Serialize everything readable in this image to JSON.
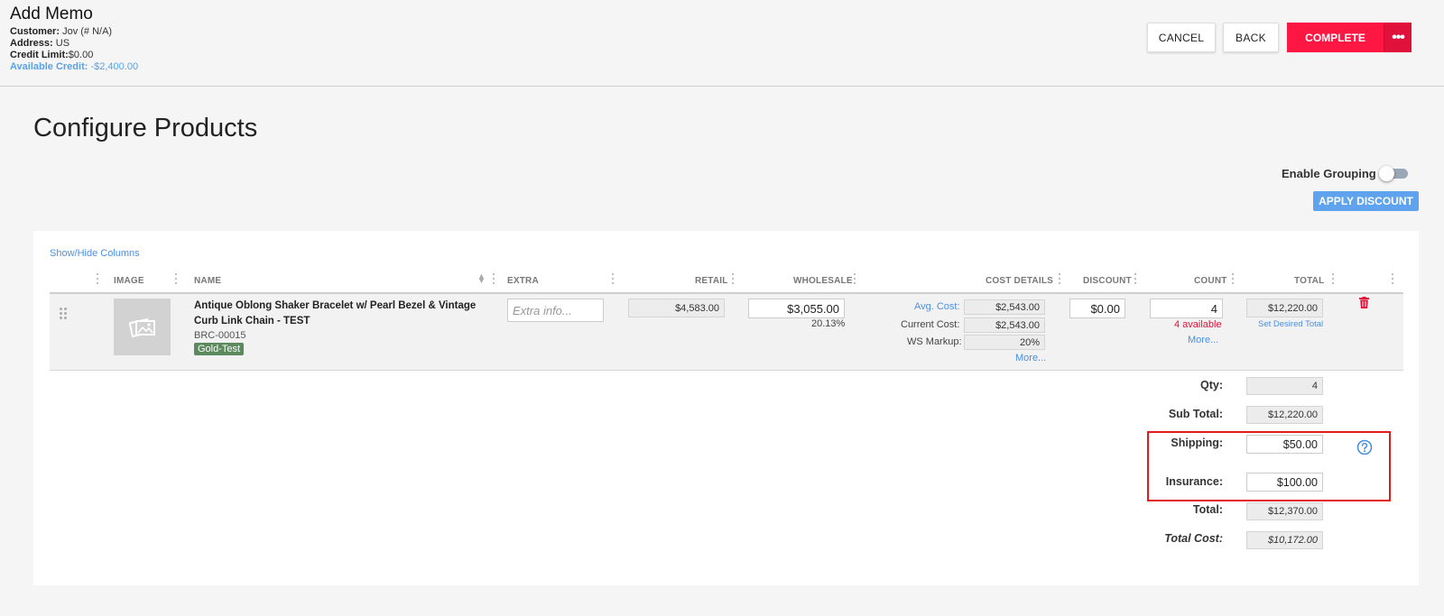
{
  "header": {
    "title": "Add Memo",
    "customer_label": "Customer:",
    "customer_value": "Jov (# N/A)",
    "address_label": "Address:",
    "address_value": "US",
    "credit_limit_label": "Credit Limit:",
    "credit_limit_value": "$0.00",
    "available_credit_label": "Available Credit:",
    "available_credit_value": "-$2,400.00",
    "cancel_label": "CANCEL",
    "back_label": "BACK",
    "complete_label": "COMPLETE",
    "more_label": "•••"
  },
  "page": {
    "title": "Configure Products",
    "enable_grouping_label": "Enable Grouping",
    "enable_grouping_on": false,
    "apply_discount_label": "APPLY DISCOUNT",
    "show_hide_label": "Show/Hide Columns"
  },
  "table": {
    "columns": [
      "IMAGE",
      "NAME",
      "EXTRA",
      "RETAIL",
      "WHOLESALE",
      "COST DETAILS",
      "DISCOUNT",
      "COUNT",
      "TOTAL"
    ],
    "row": {
      "name": "Antique Oblong Shaker Bracelet w/ Pearl Bezel & Vintage Curb Link Chain - TEST",
      "sku": "BRC-00015",
      "tag": "Gold-Test",
      "extra_placeholder": "Extra info...",
      "retail": "$4,583.00",
      "wholesale": "$3,055.00",
      "wholesale_pct": "20.13%",
      "avg_cost_label": "Avg. Cost:",
      "avg_cost": "$2,543.00",
      "current_cost_label": "Current Cost:",
      "current_cost": "$2,543.00",
      "ws_markup_label": "WS Markup:",
      "ws_markup": "20%",
      "cost_more": "More...",
      "discount": "$0.00",
      "count": "4",
      "available": "4 available",
      "count_more": "More...",
      "total": "$12,220.00",
      "set_desired_total": "Set Desired Total"
    }
  },
  "summary": {
    "qty_label": "Qty:",
    "qty": "4",
    "subtotal_label": "Sub Total:",
    "subtotal": "$12,220.00",
    "shipping_label": "Shipping:",
    "shipping": "$50.00",
    "insurance_label": "Insurance:",
    "insurance": "$100.00",
    "total_label": "Total:",
    "total": "$12,370.00",
    "total_cost_label": "Total Cost:",
    "total_cost": "$10,172.00"
  },
  "icons": {
    "image_placeholder": "image-placeholder-icon",
    "trash": "trash-icon",
    "help": "help-circle-icon",
    "drag": "drag-handle-icon"
  },
  "colors": {
    "complete": "#ff1744",
    "apply_discount": "#5fa3ee",
    "link": "#4a90e2",
    "available": "#e0123b",
    "tag": "#5a8a5e",
    "highlight_box": "#e31b1b"
  }
}
